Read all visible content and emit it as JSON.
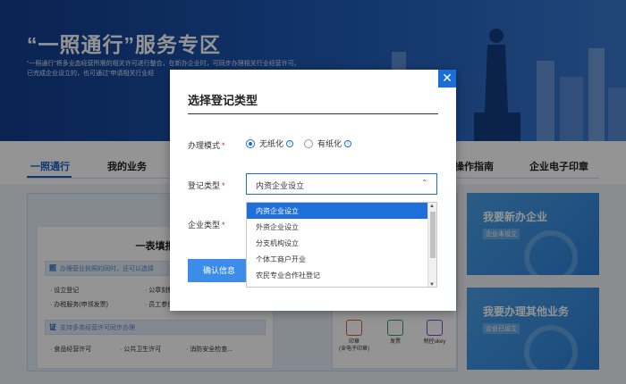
{
  "banner": {
    "title": "“一照通行”服务专区",
    "desc_line1": "“一照通行”将多业态经营所需的相关许可进行整合，在新办企业时，可同步办理相关行业经营许可。",
    "desc_line2": "已完成企业设立的，也可通过“申请相关行业经"
  },
  "nav": {
    "tabs": [
      "一照通行",
      "我的业务",
      "操作指南",
      "企业电子印章"
    ],
    "active_index": 0
  },
  "background": {
    "form_card": {
      "title": "一表填报",
      "band1_tag": "照",
      "band1_text": "办理营业执照的同时，还可以选择",
      "items_row1": [
        "· 设立登记",
        "· 公章刻制(含电子印"
      ],
      "items_row2": [
        "· 办税服务(申领发票)",
        "· 员工参保登记"
      ],
      "band2_tag": "证",
      "band2_text": "支持多类经营许可同步办理",
      "items_row3": [
        "· 食品经营许可",
        "· 公共卫生许可",
        "· 消防安全检查..."
      ]
    },
    "stamps": [
      {
        "label": "印章\n(含电子印章)",
        "color": "#e2573c"
      },
      {
        "label": "发票",
        "color": "#2f9e62"
      },
      {
        "label": "税控ukey",
        "color": "#7a4bd1"
      }
    ],
    "right_cards": [
      {
        "title": "我要新办企业",
        "sub": "企业未设立"
      },
      {
        "title": "我要办理其他业务",
        "sub": "企业已设立"
      }
    ]
  },
  "modal": {
    "title": "选择登记类型",
    "close_glyph": "✕",
    "mode_label": "办理模式",
    "required_mark": "*",
    "mode_options": [
      {
        "label": "无纸化",
        "selected": true
      },
      {
        "label": "有纸化",
        "selected": false
      }
    ],
    "info_glyph": "i",
    "reg_type_label": "登记类型",
    "reg_type_value": "内资企业设立",
    "caret": "⌃",
    "company_type_label": "企业类型",
    "dropdown_options": [
      "内资企业设立",
      "外资企业设立",
      "分支机构设立",
      "个体工商户开业",
      "农民专业合作社登记"
    ],
    "selected_option_index": 0,
    "confirm_label": "确认信息"
  },
  "colors": {
    "accent": "#1a6ed8",
    "selected_option": "#1e6fd9",
    "required": "#e02020"
  }
}
